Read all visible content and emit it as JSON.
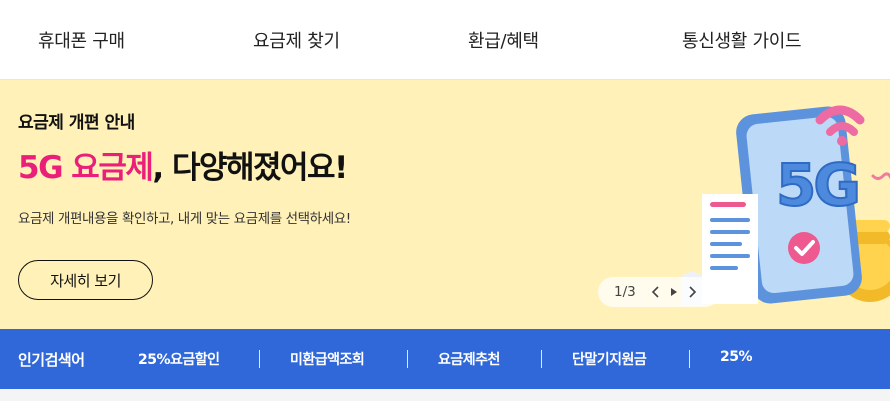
{
  "nav": {
    "items": [
      {
        "label": "휴대폰 구매"
      },
      {
        "label": "요금제 찾기"
      },
      {
        "label": "환급/혜택"
      },
      {
        "label": "통신생활 가이드"
      }
    ]
  },
  "banner": {
    "eyebrow": "요금제 개편 안내",
    "headline_accent": "5G 요금제",
    "headline_rest": ", 다양해졌어요!",
    "description": "요금제 개편내용을 확인하고, 내게 맞는 요금제를 선택하세요!",
    "cta_label": "자세히 보기",
    "illustration_text": "5G",
    "pager": {
      "count": "1/3"
    }
  },
  "keywords": {
    "title": "인기검색어",
    "items": [
      {
        "label": "25%요금할인"
      },
      {
        "label": "미환급액조회"
      },
      {
        "label": "요금제추천"
      },
      {
        "label": "단말기지원금"
      },
      {
        "label": "25%"
      }
    ]
  },
  "colors": {
    "accent_pink": "#ea1f79",
    "banner_bg": "#fff1b8",
    "keyword_bar": "#3068da"
  }
}
